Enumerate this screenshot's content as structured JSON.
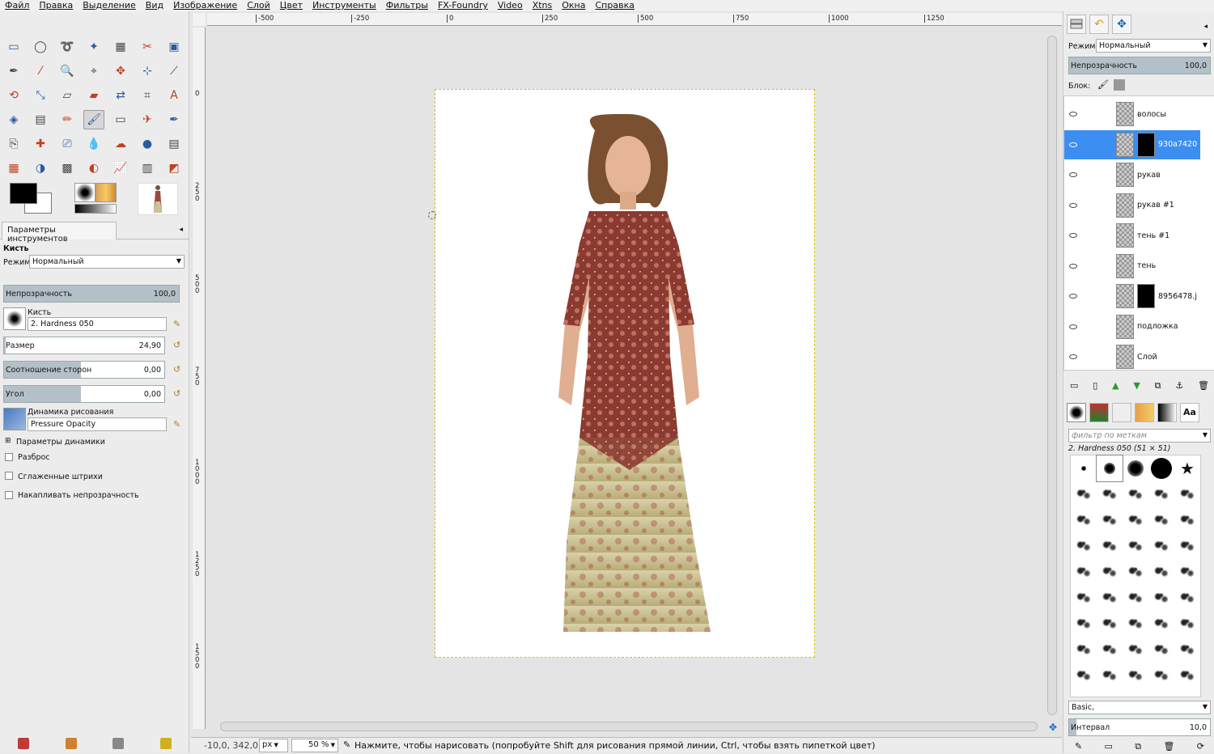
{
  "menu": [
    "Файл",
    "Правка",
    "Выделение",
    "Вид",
    "Изображение",
    "Слой",
    "Цвет",
    "Инструменты",
    "Фильтры",
    "FX-Foundry",
    "Video",
    "Xtns",
    "Окна",
    "Справка"
  ],
  "tool_options": {
    "tab_title": "Параметры инструментов",
    "tool_name": "Кисть",
    "mode_label": "Режим:",
    "mode_value": "Нормальный",
    "opacity_label": "Непрозрачность",
    "opacity_value": "100,0",
    "brush_label": "Кисть",
    "brush_value": "2. Hardness 050",
    "size_label": "Размер",
    "size_value": "24,90",
    "aspect_label": "Соотношение сторон",
    "aspect_value": "0,00",
    "angle_label": "Угол",
    "angle_value": "0,00",
    "dynamics_label": "Динамика рисования",
    "dynamics_value": "Pressure Opacity",
    "dynamics_options_label": "Параметры динамики",
    "jitter_label": "Разброс",
    "smooth_label": "Сглаженные штрихи",
    "incremental_label": "Накапливать непрозрачность"
  },
  "rulers": {
    "horizontal": [
      "-500",
      "-250",
      "0",
      "250",
      "500",
      "750",
      "1000",
      "1250"
    ],
    "vertical": [
      "0",
      "250",
      "500",
      "750",
      "1000",
      "1250",
      "1500"
    ]
  },
  "status": {
    "coords": "-10,0, 342,0",
    "unit": "px",
    "zoom": "50 %",
    "message": "Нажмите, чтобы нарисовать (попробуйте Shift для рисования прямой линии, Ctrl, чтобы взять пипеткой цвет)"
  },
  "layers_panel": {
    "mode_label": "Режим:",
    "mode_value": "Нормальный",
    "opacity_label": "Непрозрачность",
    "opacity_value": "100,0",
    "lock_label": "Блок:",
    "layers": [
      {
        "name": "волосы",
        "selected": false,
        "mask": false
      },
      {
        "name": "930a7420",
        "selected": true,
        "mask": true
      },
      {
        "name": "рукав",
        "selected": false,
        "mask": false
      },
      {
        "name": "рукав #1",
        "selected": false,
        "mask": false
      },
      {
        "name": "тень #1",
        "selected": false,
        "mask": false
      },
      {
        "name": "тень",
        "selected": false,
        "mask": false
      },
      {
        "name": "8956478.j",
        "selected": false,
        "mask": true
      },
      {
        "name": "подложка",
        "selected": false,
        "mask": false
      },
      {
        "name": "Слой",
        "selected": false,
        "mask": false
      }
    ]
  },
  "brushes_panel": {
    "filter_placeholder": "фильтр по меткам",
    "current_brush": "2. Hardness 050 (51 × 51)",
    "preset": "Basic,",
    "spacing_label": "Интервал",
    "spacing_value": "10,0"
  },
  "colors": {
    "foreground": "#000000",
    "background": "#ffffff",
    "selection": "#3c8ff0"
  }
}
